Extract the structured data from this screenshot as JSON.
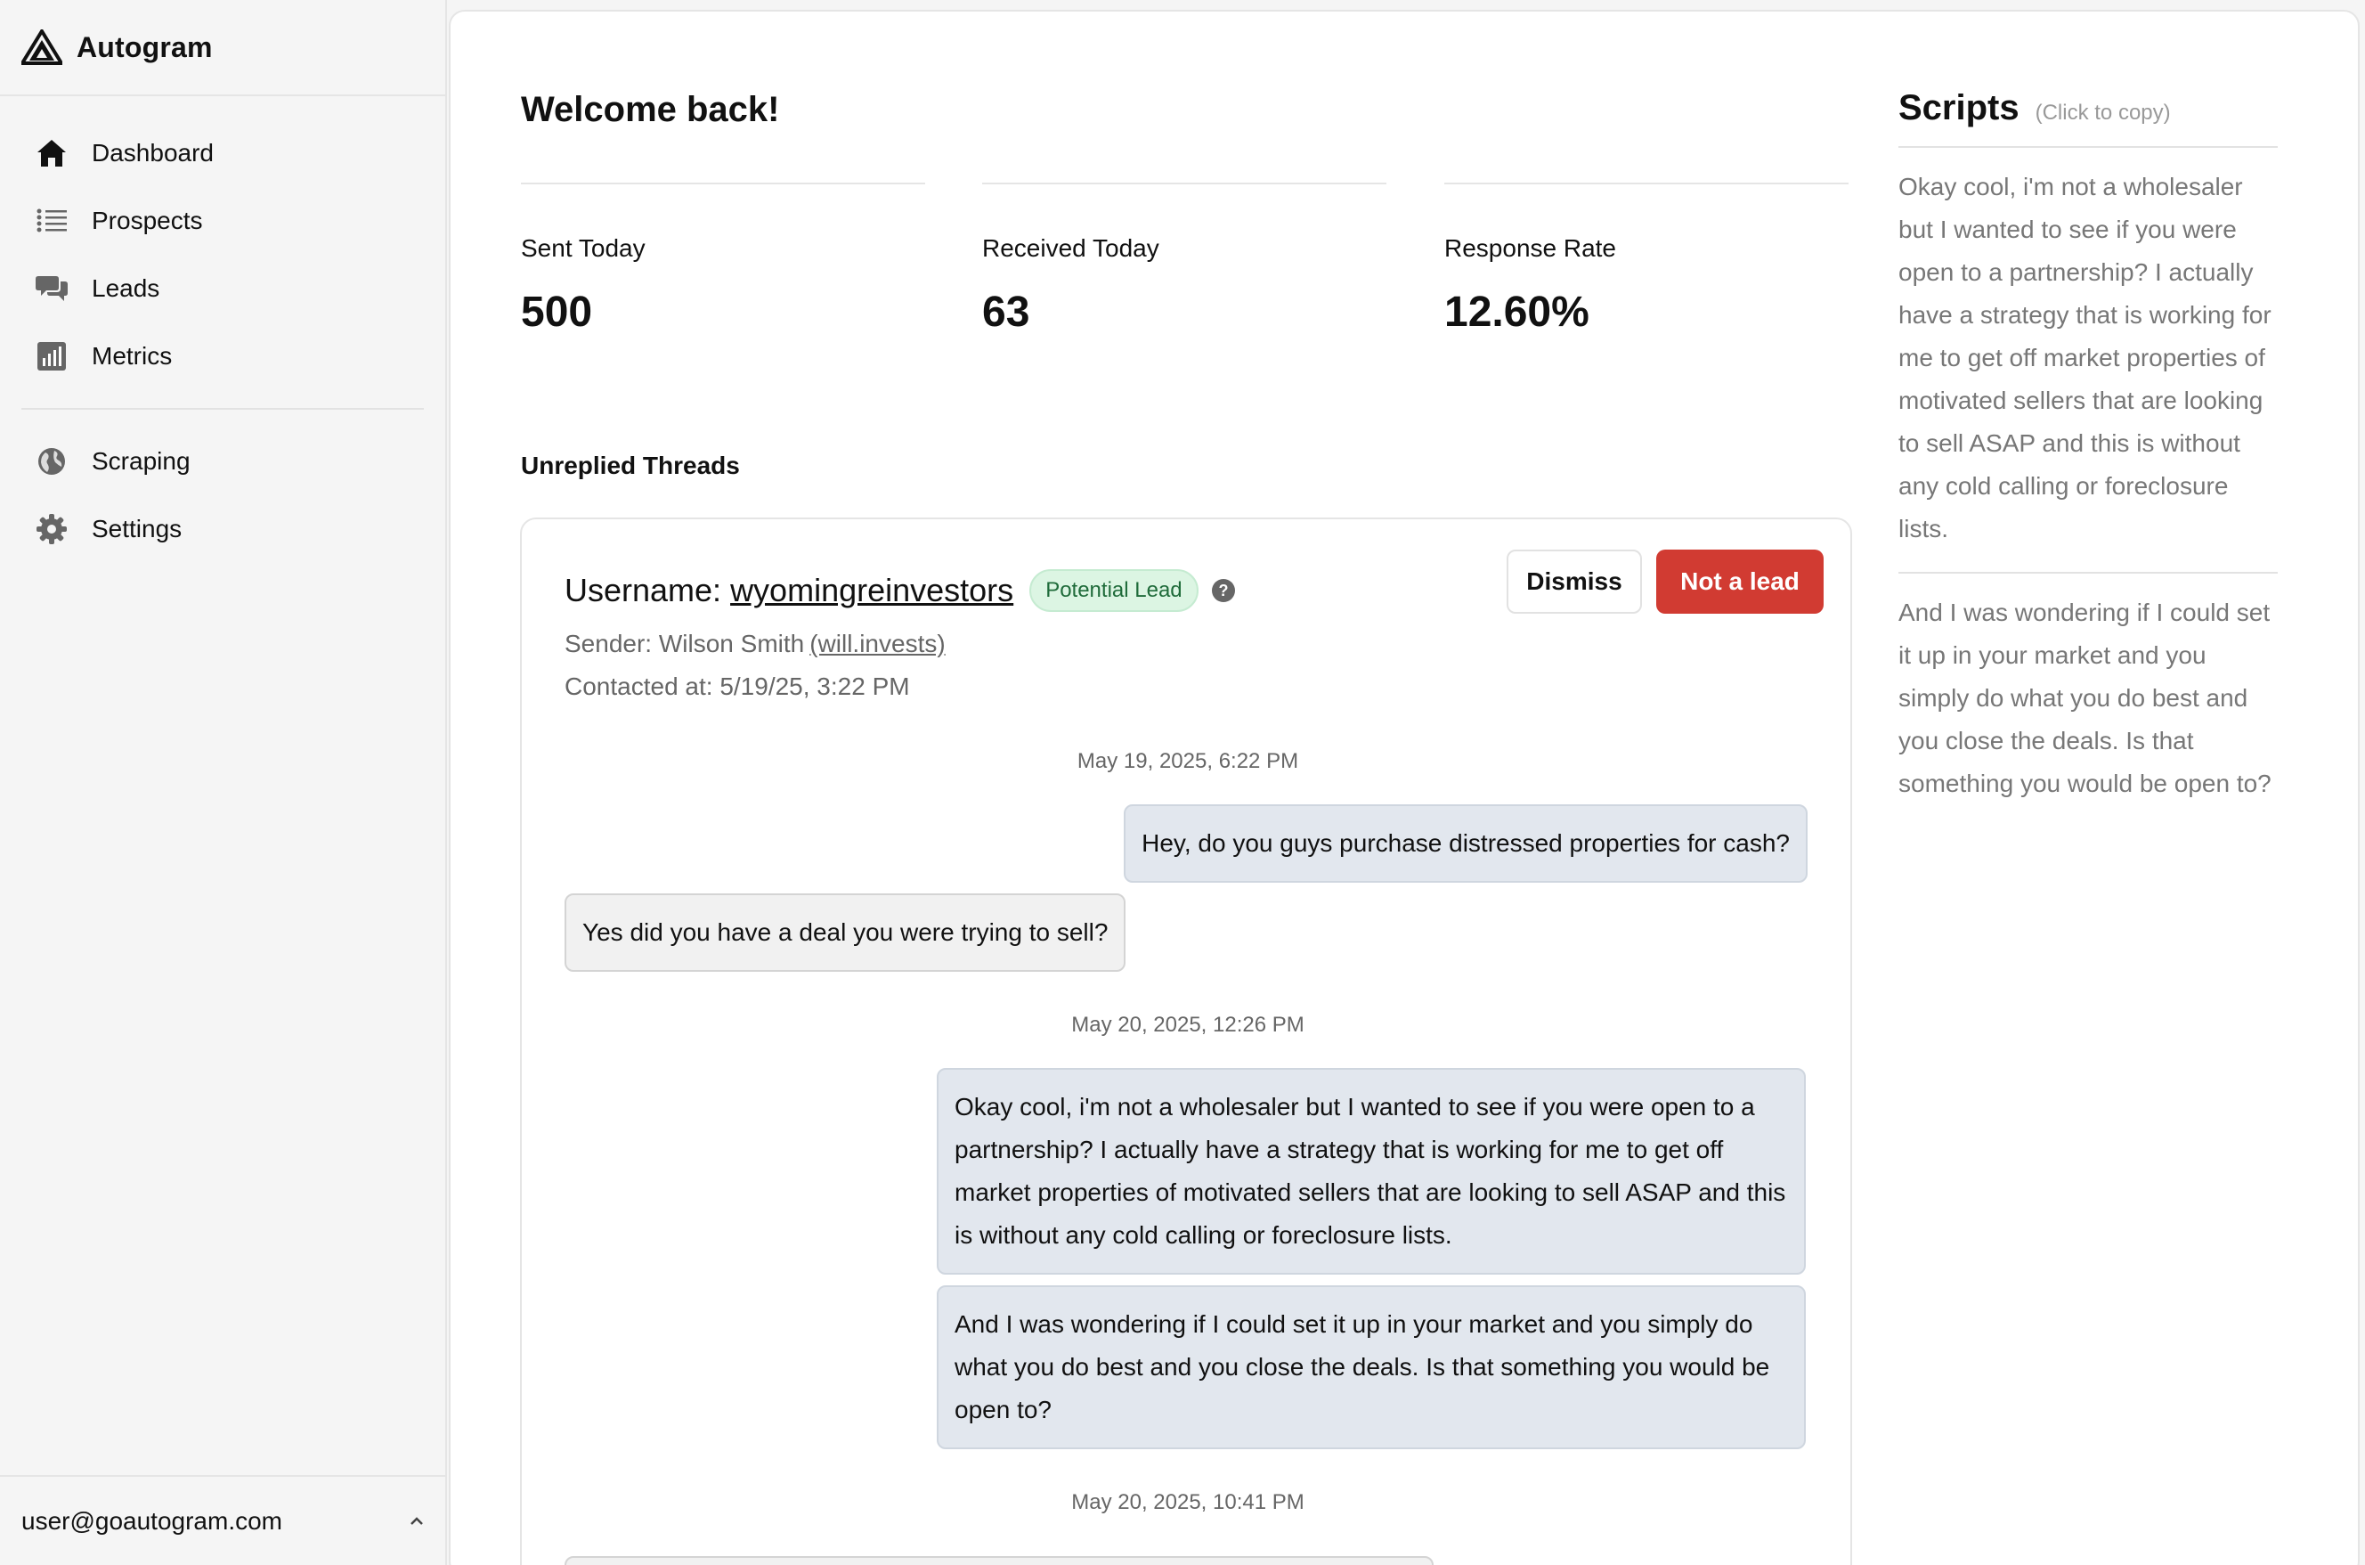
{
  "brand": {
    "name": "Autogram"
  },
  "sidebar": {
    "items": [
      {
        "label": "Dashboard",
        "icon": "home-icon"
      },
      {
        "label": "Prospects",
        "icon": "list-icon"
      },
      {
        "label": "Leads",
        "icon": "chat-icon"
      },
      {
        "label": "Metrics",
        "icon": "bar-chart-icon"
      },
      {
        "label": "Scraping",
        "icon": "globe-icon"
      },
      {
        "label": "Settings",
        "icon": "gear-icon"
      }
    ],
    "user_email": "user@goautogram.com"
  },
  "main": {
    "welcome": "Welcome back!",
    "stats": [
      {
        "label": "Sent Today",
        "value": "500"
      },
      {
        "label": "Received Today",
        "value": "63"
      },
      {
        "label": "Response Rate",
        "value": "12.60%"
      }
    ],
    "threads_title": "Unreplied Threads",
    "thread": {
      "username_prefix": "Username:",
      "username": "wyomingreinvestors",
      "badge": "Potential Lead",
      "sender_prefix": "Sender: Wilson Smith",
      "sender_handle": "(will.invests)",
      "contacted": "Contacted at: 5/19/25, 3:22 PM",
      "dismiss_label": "Dismiss",
      "not_lead_label": "Not a lead",
      "timestamps": [
        "May 19, 2025, 6:22 PM",
        "May 20, 2025, 12:26 PM",
        "May 20, 2025, 10:41 PM"
      ],
      "messages": [
        {
          "direction": "out",
          "text": "Hey, do you guys purchase distressed properties for cash?"
        },
        {
          "direction": "in",
          "text": "Yes did you have a deal you were trying to sell?"
        },
        {
          "direction": "out",
          "text": "Okay cool, i'm not a wholesaler but I wanted to see if you were open to a partnership? I actually have a strategy that is working for me to get off market properties of motivated sellers that are looking to sell ASAP and this is without any cold calling or foreclosure lists."
        },
        {
          "direction": "out",
          "text": "And I was wondering if I could set it up in your market and you simply do what you do best and you close the deals. Is that something you would be open to?"
        }
      ]
    }
  },
  "scripts": {
    "title": "Scripts",
    "hint": "(Click to copy)",
    "items": [
      "Okay cool, i'm not a wholesaler but I wanted to see if you were open to a partnership? I actually have a strategy that is working for me to get off market properties of motivated sellers that are looking to sell ASAP and this is without any cold calling or foreclosure lists.",
      "And I was wondering if I could set it up in your market and you simply do what you do best and you close the deals. Is that something you would be open to?"
    ]
  },
  "colors": {
    "accent_red": "#d13b32",
    "badge_green": "#dcf5e3",
    "outgoing_bubble": "#e2e7ee"
  }
}
